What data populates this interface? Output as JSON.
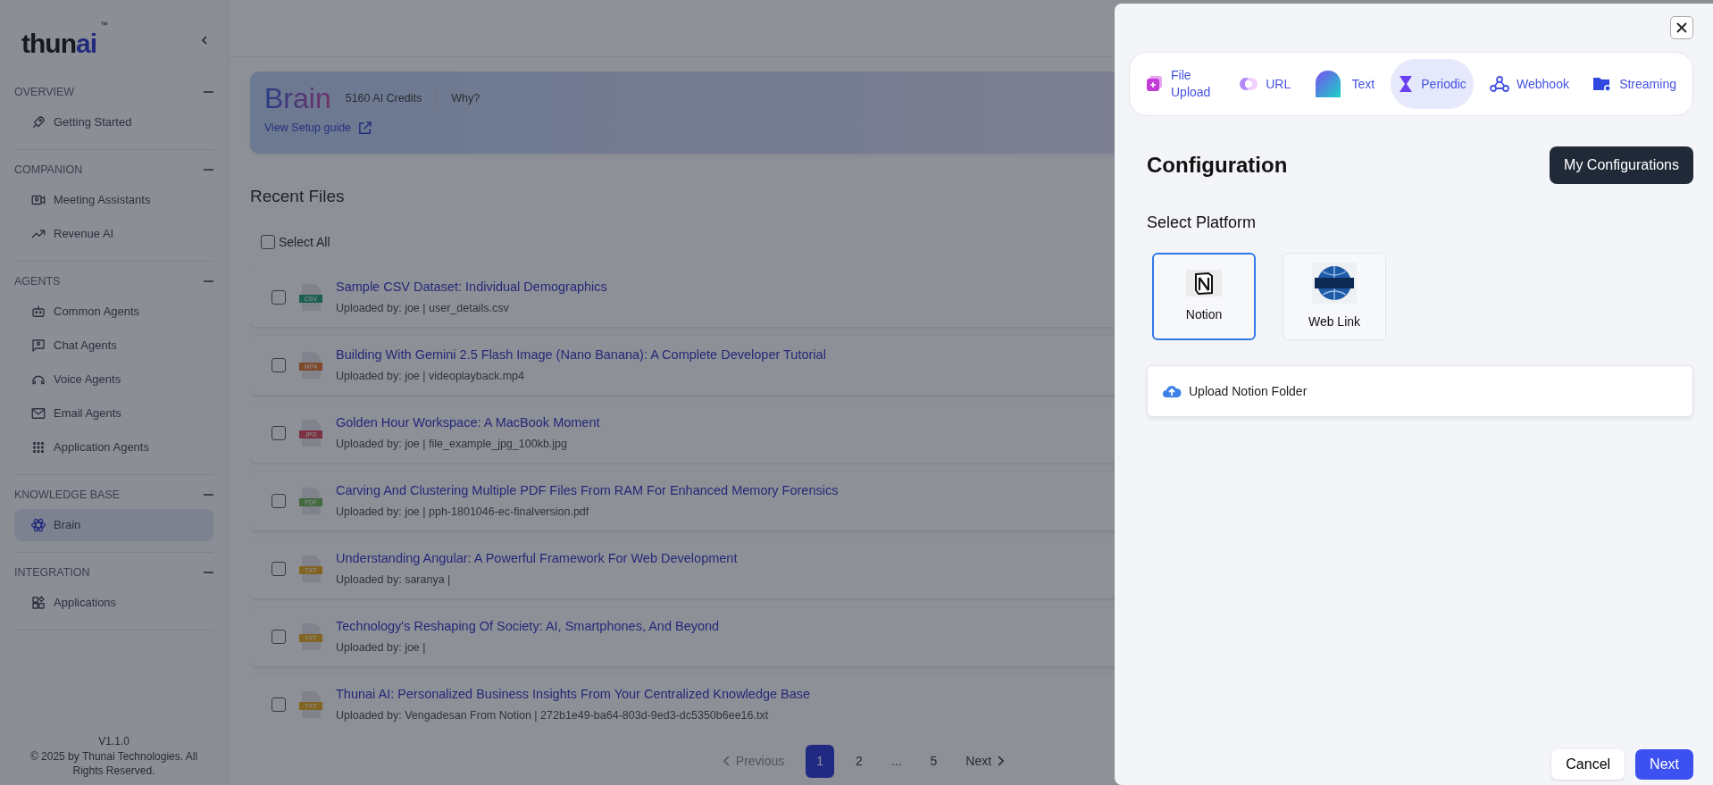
{
  "sidebar": {
    "logo": {
      "text": "thun",
      "accent": "ai",
      "mark": "™"
    },
    "sections": [
      {
        "title": "OVERVIEW",
        "expanded": true,
        "items": [
          {
            "label": "Getting Started",
            "kind": "rocket",
            "selected": false
          }
        ]
      },
      {
        "title": "COMPANION",
        "expanded": true,
        "items": [
          {
            "label": "Meeting Assistants",
            "kind": "video",
            "selected": false
          },
          {
            "label": "Revenue AI",
            "kind": "trend",
            "selected": false
          }
        ]
      },
      {
        "title": "AGENTS",
        "expanded": true,
        "items": [
          {
            "label": "Common Agents",
            "kind": "robot",
            "selected": false
          },
          {
            "label": "Chat Agents",
            "kind": "chat",
            "selected": false
          },
          {
            "label": "Voice Agents",
            "kind": "voice",
            "selected": false
          },
          {
            "label": "Email Agents",
            "kind": "mail",
            "selected": false
          },
          {
            "label": "Application Agents",
            "kind": "grid",
            "selected": false
          }
        ]
      },
      {
        "title": "KNOWLEDGE BASE",
        "expanded": true,
        "items": [
          {
            "label": "Brain",
            "kind": "atom",
            "selected": true
          }
        ]
      },
      {
        "title": "INTEGRATION",
        "expanded": true,
        "items": [
          {
            "label": "Applications",
            "kind": "apps",
            "selected": false
          }
        ]
      }
    ],
    "version": "V1.1.0",
    "copyright": "© 2025 by Thunai Technologies. All Rights Reserved."
  },
  "header": {
    "title": "Brain",
    "credits": "5160 AI Credits",
    "why": "Why?",
    "guide_link": "View Setup guide"
  },
  "recent_files": {
    "title": "Recent Files",
    "select_all": {
      "label": "Select All",
      "checked": false
    },
    "files": [
      {
        "title": "Sample CSV Dataset: Individual Demographics",
        "meta": "Uploaded by: joe | user_details.csv",
        "type": "CSV",
        "kind": "csv",
        "checked": false
      },
      {
        "title": "Building With Gemini 2.5 Flash Image (Nano Banana): A Complete Developer Tutorial",
        "meta": "Uploaded by: joe | videoplayback.mp4",
        "type": "MP4",
        "kind": "mp4",
        "checked": false
      },
      {
        "title": "Golden Hour Workspace: A MacBook Moment",
        "meta": "Uploaded by: joe | file_example_jpg_100kb.jpg",
        "type": "JPG",
        "kind": "jpg",
        "checked": false
      },
      {
        "title": "Carving And Clustering Multiple PDF Files From RAM For Enhanced Memory Forensics",
        "meta": "Uploaded by: joe | pph-1801046-ec-finalversion.pdf",
        "type": "PDF",
        "kind": "pdf",
        "checked": false
      },
      {
        "title": "Understanding Angular: A Powerful Framework For Web Development",
        "meta": "Uploaded by: saranya |",
        "type": "TXT",
        "kind": "txt",
        "checked": false
      },
      {
        "title": "Technology's Reshaping Of Society: AI, Smartphones, And Beyond",
        "meta": "Uploaded by: joe |",
        "type": "TXT",
        "kind": "txt",
        "checked": false
      },
      {
        "title": "Thunai AI: Personalized Business Insights From Your Centralized Knowledge Base",
        "meta": "Uploaded by: Vengadesan From Notion | 272b1e49-ba64-803d-9ed3-dc5350b6ee16.txt",
        "type": "TXT",
        "kind": "txt",
        "checked": false
      }
    ]
  },
  "pagination": {
    "previous": {
      "label": "Previous",
      "disabled": true
    },
    "pages": [
      {
        "label": "1",
        "selected": true
      },
      {
        "label": "2",
        "selected": false
      },
      {
        "label": "...",
        "selected": false
      },
      {
        "label": "5",
        "selected": false
      }
    ],
    "next": {
      "label": "Next",
      "disabled": false
    }
  },
  "panel": {
    "tabs": [
      {
        "label": "File Upload",
        "kind": "file",
        "selected": false
      },
      {
        "label": "URL",
        "kind": "url",
        "selected": false
      },
      {
        "label": "Text",
        "kind": "text",
        "selected": false
      },
      {
        "label": "Periodic",
        "kind": "periodic",
        "selected": true
      },
      {
        "label": "Webhook",
        "kind": "webhook",
        "selected": false
      },
      {
        "label": "Streaming",
        "kind": "streaming",
        "selected": false
      }
    ],
    "title": "Configuration",
    "my_configurations": "My Configurations",
    "select_platform": "Select Platform",
    "platforms": [
      {
        "label": "Notion",
        "kind": "notion",
        "selected": true
      },
      {
        "label": "Web Link",
        "kind": "web",
        "selected": false
      }
    ],
    "upload": "Upload Notion Folder",
    "cancel": "Cancel",
    "next": "Next"
  }
}
